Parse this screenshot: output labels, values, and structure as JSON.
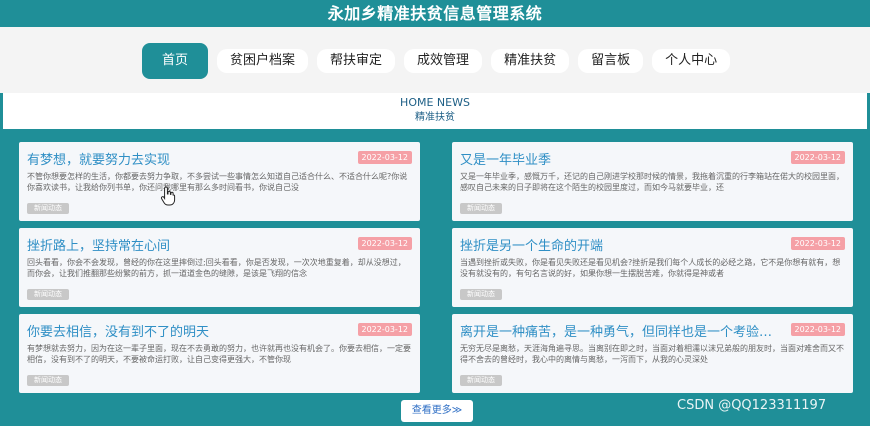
{
  "header": {
    "title": "永加乡精准扶贫信息管理系统"
  },
  "nav": {
    "items": [
      {
        "label": "首页",
        "active": true
      },
      {
        "label": "贫困户档案"
      },
      {
        "label": "帮扶审定"
      },
      {
        "label": "成效管理"
      },
      {
        "label": "精准扶贫"
      },
      {
        "label": "留言板"
      },
      {
        "label": "个人中心"
      }
    ]
  },
  "news": {
    "heading_en": "HOME NEWS",
    "heading_cn": "精准扶贫",
    "cards": [
      {
        "title": "有梦想，就要努力去实现",
        "date": "2022-03-12",
        "text": "不管你想要怎样的生活，你都要去努力争取，不多尝试一些事情怎么知道自己适合什么、不适合什么呢?你说你喜欢读书，让我给你列书单，你还问我哪里有那么多时间看书，你说自己没",
        "tag": "新闻动态"
      },
      {
        "title": "又是一年毕业季",
        "date": "2022-03-12",
        "text": "又是一年毕业季，感慨万千，还记的自己刚进学校那时候的情景，我拖着沉重的行李箱站在偌大的校园里面，感叹自己未来的日子即将在这个陌生的校园里度过，而如今马就要毕业，还",
        "tag": "新闻动态"
      },
      {
        "title": "挫折路上，坚持常在心间",
        "date": "2022-03-12",
        "text": "回头看看，你会不会发现，曾经的你在这里摔倒过;回头看看，你是否发现，一次次地重复着，却从没想过，而你会，让我们推翻那些纷繁的前方，抓一道道金色的缝隙，是该是飞翔的信念",
        "tag": "新闻动态"
      },
      {
        "title": "挫折是另一个生命的开端",
        "date": "2022-03-12",
        "text": "当遇到挫折或失败，你是看见失败还是看见机会?挫折是我们每个人成长的必经之路，它不是你想有就有，想没有就没有的，有句名言说的好，如果你想一生摆脱苦难，你就得是神或者",
        "tag": "新闻动态"
      },
      {
        "title": "你要去相信，没有到不了的明天",
        "date": "2022-03-12",
        "text": "有梦想就去努力，因为在这一辈子里面，现在不去勇敢的努力，也许就再也没有机会了。你要去相信，一定要相信，没有到不了的明天，不要被命运打败，让自己变得更强大，不管你现",
        "tag": "新闻动态"
      },
      {
        "title": "离开是一种痛苦，是一种勇气，但同样也是一个考验，是一个新的开始",
        "date": "2022-03-12",
        "text": "无穷无尽是离愁，天涯海角遍寻思。当离别在即之时，当面对着相濡以沫兄弟般的朋友时，当面对难舍而又不得不舍去的曾经时，我心中的离情与离愁，一泻而下，从我的心灵深处",
        "tag": "新闻动态"
      }
    ]
  },
  "more_button": "查看更多≫",
  "watermark": "CSDN @QQ123311197",
  "colors": {
    "accent": "#1f8f98",
    "date_badge": "#f5a0a6",
    "title_link": "#2f8fc5"
  }
}
